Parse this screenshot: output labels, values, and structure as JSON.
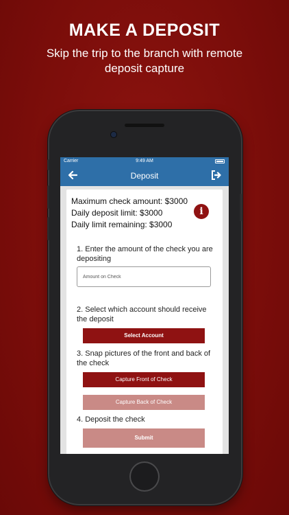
{
  "promo": {
    "title": "MAKE A DEPOSIT",
    "subtitle": "Skip the trip to the branch with remote deposit capture"
  },
  "status_bar": {
    "carrier": "Carrier",
    "time": "9:49 AM"
  },
  "nav": {
    "title": "Deposit",
    "back_icon": "arrow-left-icon",
    "logout_icon": "logout-icon"
  },
  "limits": {
    "max_check": "Maximum check amount: $3000",
    "daily_limit": "Daily deposit limit: $3000",
    "daily_remaining": "Daily limit remaining: $3000"
  },
  "info_icon": "i",
  "steps": {
    "step1": "1. Enter the amount of the check you are depositing",
    "amount_placeholder": "Amount on Check",
    "step2": "2. Select which account should receive the deposit",
    "select_account": "Select Account",
    "step3": "3. Snap pictures of the front and back of the check",
    "capture_front": "Capture Front of Check",
    "capture_back": "Capture Back of Check",
    "step4": "4. Deposit the check",
    "submit": "Submit"
  },
  "colors": {
    "background": "#7a0d0a",
    "nav_blue": "#2e6fa8",
    "primary_button": "#8f1212",
    "disabled_button": "#c98a86"
  }
}
